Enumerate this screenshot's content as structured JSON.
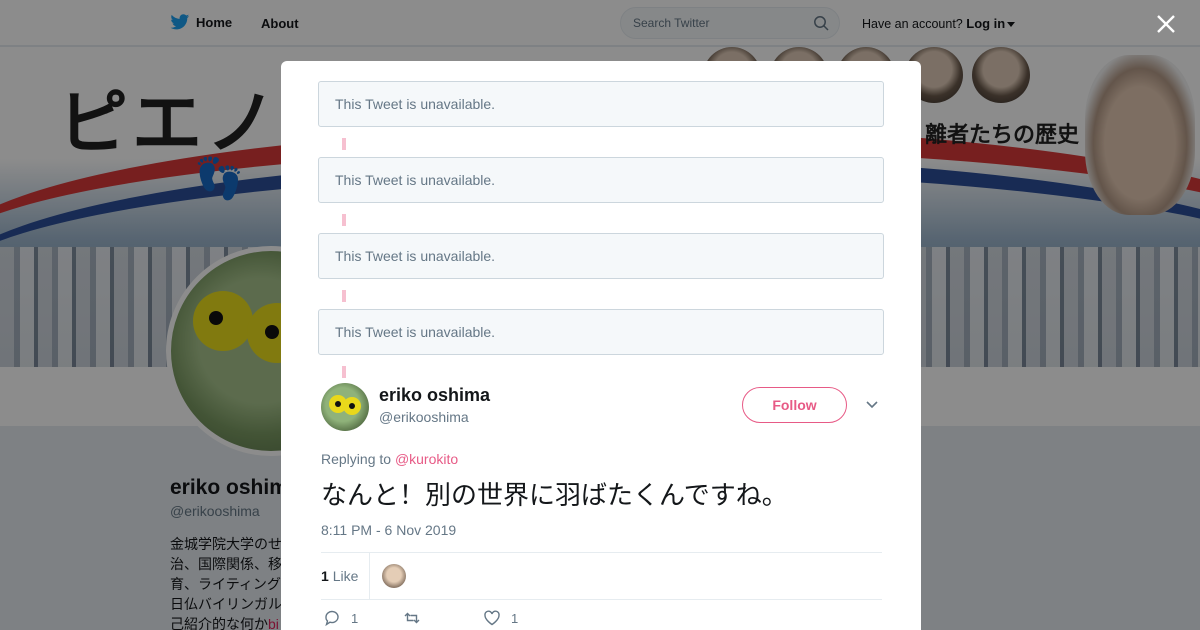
{
  "nav": {
    "home_label": "Home",
    "about_label": "About",
    "search_placeholder": "Search Twitter",
    "account_prompt": "Have an account?",
    "login_label": "Log in"
  },
  "banner": {
    "title_text": "ピエノ",
    "subtitle_text": "離者たちの歴史"
  },
  "profile": {
    "name": "eriko oshima",
    "handle": "@erikooshima",
    "bio_lines": [
      "金城学院大学のせ",
      "治、国際関係、移",
      "育、ライティング",
      "日仏バイリンガル",
      "己紹介的な何か"
    ],
    "bio_link": "bi"
  },
  "thread": {
    "unavailable_text": "This Tweet is unavailable."
  },
  "tweet": {
    "author_name": "eriko oshima",
    "author_handle": "@erikooshima",
    "follow_label": "Follow",
    "replying_to_label": "Replying to",
    "replying_to_handle": "@kurokito",
    "text": "なんと！別の世界に羽ばたくんですね。",
    "timestamp": "8:11 PM - 6 Nov 2019",
    "like_count": "1",
    "like_label": "Like",
    "reply_count": "1",
    "retweet_count": "",
    "heart_count": "1"
  },
  "colors": {
    "accent": "#e0245e",
    "twitter_blue": "#1da1f2",
    "thread_line": "#f6c0d0"
  },
  "icons": [
    "twitter-bird-icon",
    "search-icon",
    "close-icon",
    "chevron-down-icon",
    "reply-icon",
    "retweet-icon",
    "heart-icon"
  ]
}
